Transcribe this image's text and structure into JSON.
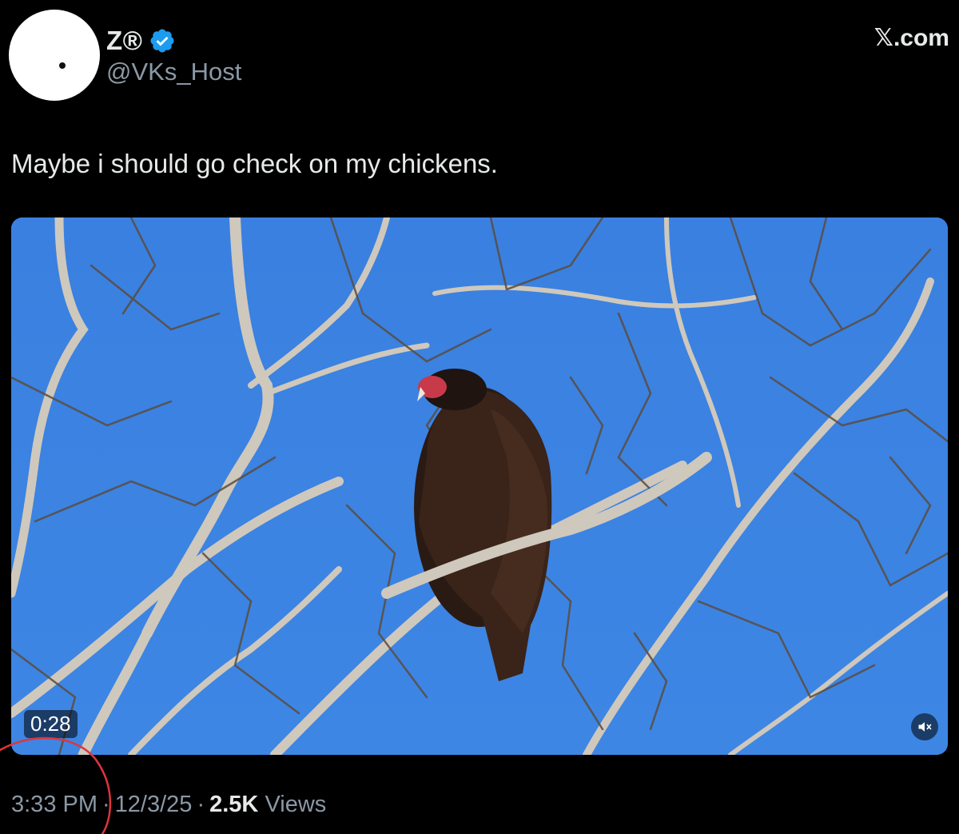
{
  "author": {
    "display_name": "Z®",
    "handle": "@VKs_Host",
    "verified": true
  },
  "brand": "𝕏.com",
  "tweet": {
    "text": "Maybe i should go check on my chickens."
  },
  "media": {
    "type": "video",
    "duration": "0:28",
    "muted": true,
    "icons": {
      "mute": "speaker-muted-icon"
    }
  },
  "meta": {
    "time": "3:33 PM",
    "separator": "·",
    "date": "12/3/25",
    "views_count": "2.5K",
    "views_label": "Views"
  },
  "colors": {
    "background": "#000000",
    "text_primary": "#e7e9ea",
    "text_secondary": "#8b98a5",
    "verified_badge": "#1d9bf0",
    "sky": "#3c82e1",
    "annotation_circle": "#e0343b"
  }
}
